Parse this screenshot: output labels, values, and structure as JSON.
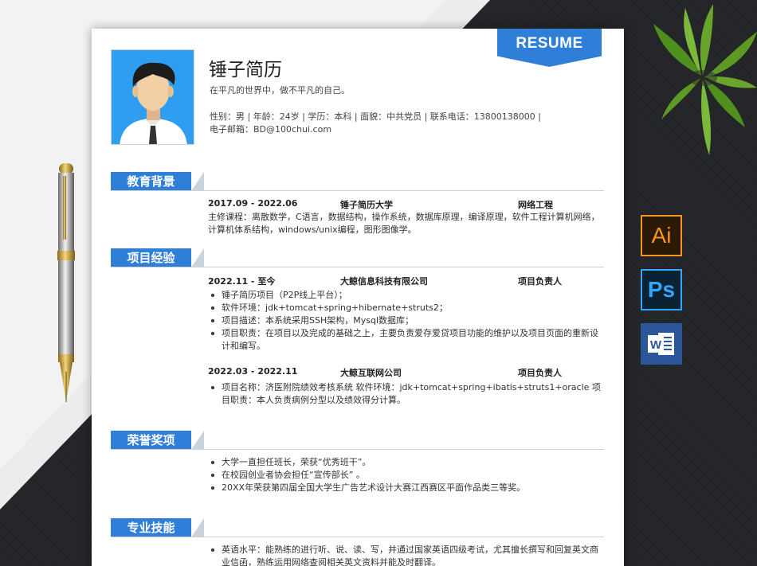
{
  "resume": {
    "tag": "RESUME",
    "name": "锤子简历",
    "motto": "在平凡的世界中，做不平凡的自己。",
    "info_line1": "性别：男 | 年龄：24岁 | 学历：本科 | 面貌：中共党员 | 联系电话：13800138000 |",
    "info_line2": "电子邮箱：BD@100chui.com"
  },
  "sections": {
    "education": {
      "title": "教育背景",
      "period": "2017.09 - 2022.06",
      "school": "锤子简历大学",
      "major": "网络工程",
      "courses": "主修课程：离散数学，C语言，数据结构，操作系统，数据库原理，编译原理，软件工程计算机网络，计算机体系结构，windows/unix编程，图形图像学。"
    },
    "projects": {
      "title": "项目经验",
      "items": [
        {
          "period": "2022.11 - 至今",
          "company": "大鲸信息科技有限公司",
          "role": "项目负责人",
          "bullets": [
            "锤子简历项目（P2P线上平台）；",
            "软件环境：jdk+tomcat+spring+hibernate+struts2；",
            "项目描述：本系统采用SSH架构，Mysql数据库；",
            "项目职责：在项目以及完成的基础之上，主要负责爱存爱贷项目功能的维护以及项目页面的重新设计和编写。"
          ]
        },
        {
          "period": "2022.03 - 2022.11",
          "company": "大鲸互联网公司",
          "role": "项目负责人",
          "bullets": [
            "项目名称：济医附院绩效考核系统 软件环境：jdk+tomcat+spring+ibatis+struts1+oracle 项目职责：本人负责病例分型以及绩效得分计算。"
          ]
        }
      ]
    },
    "honors": {
      "title": "荣誉奖项",
      "bullets": [
        "大学一直担任班长，荣获“优秀班干”。",
        "在校园创业者协会担任“宣传部长” 。",
        "20XX年荣获第四届全国大学生广告艺术设计大赛江西赛区平面作品类三等奖。"
      ]
    },
    "skills": {
      "title": "专业技能",
      "bullets": [
        "英语水平：能熟练的进行听、说、读、写，并通过国家英语四级考试，尤其擅长撰写和回复英文商业信函，熟练运用网络查阅相关英文资料并能及时翻译。"
      ]
    }
  },
  "software_icons": {
    "ai": "Ai",
    "ps": "Ps",
    "word": "W"
  },
  "colors": {
    "accent": "#2f7fd8",
    "background_dark": "#232427",
    "background_light": "#ececec"
  }
}
